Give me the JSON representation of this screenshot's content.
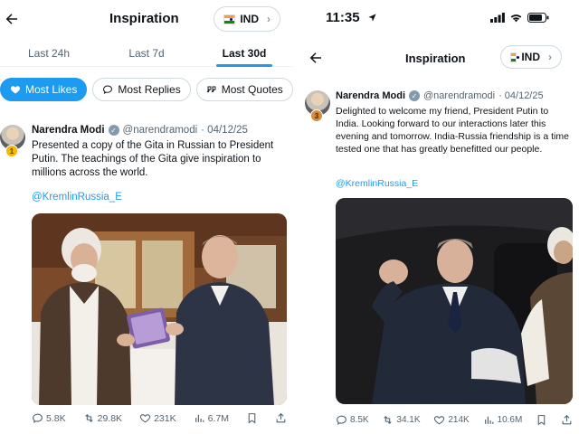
{
  "left": {
    "header": {
      "title": "Inspiration",
      "country": "IND"
    },
    "tabs": [
      {
        "label": "Last 24h"
      },
      {
        "label": "Last 7d"
      },
      {
        "label": "Last 30d"
      }
    ],
    "active_tab": "Last 30d",
    "filters": [
      {
        "label": "Most Likes"
      },
      {
        "label": "Most Replies"
      },
      {
        "label": "Most Quotes"
      }
    ],
    "tweet": {
      "rank": "1",
      "name": "Narendra Modi",
      "handle": "@narendramodi",
      "date": "· 04/12/25",
      "text": "Presented a copy of the Gita in Russian to President Putin. The teachings of the Gita give inspiration to millions across the world.",
      "mention": "@KremlinRussia_E",
      "stats": {
        "replies": "5.8K",
        "reposts": "29.8K",
        "likes": "231K",
        "views": "6.7M"
      }
    }
  },
  "right": {
    "status_bar": {
      "time": "11:35"
    },
    "header": {
      "title": "Inspiration",
      "country": "IND"
    },
    "tweet": {
      "rank": "3",
      "name": "Narendra Modi",
      "handle": "@narendramodi",
      "date": "· 04/12/25",
      "text": "Delighted to welcome my friend, President Putin to India. Looking forward to our interactions later this evening and tomorrow. India-Russia friendship is a time tested one that has greatly benefitted our people.",
      "mention": "@KremlinRussia_E",
      "stats": {
        "replies": "8.5K",
        "reposts": "34.1K",
        "likes": "214K",
        "views": "10.6M"
      }
    }
  },
  "colors": {
    "accent": "#1d9bf0",
    "text": "#0f1419",
    "muted": "#536471",
    "border": "#cfd9de"
  }
}
